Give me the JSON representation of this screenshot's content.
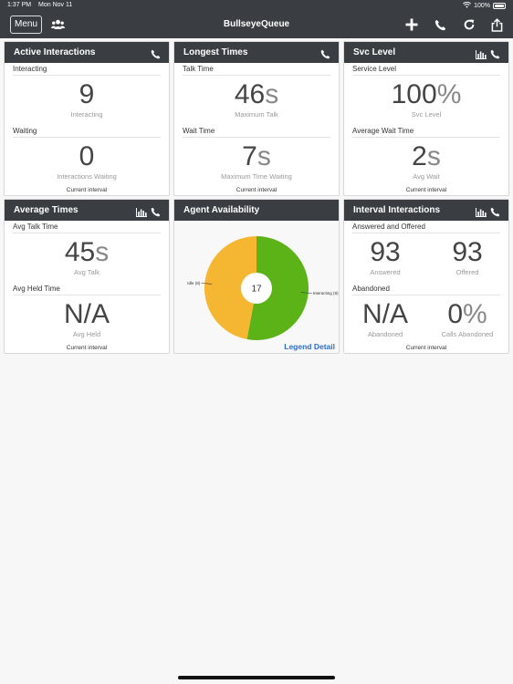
{
  "status_bar": {
    "time": "1:37 PM",
    "date": "Mon Nov 11",
    "battery": "100%"
  },
  "nav": {
    "menu_label": "Menu",
    "title": "BullseyeQueue"
  },
  "panels": {
    "active": {
      "title": "Active Interactions",
      "s1_label": "Interacting",
      "s1_value": "9",
      "s1_sub": "Interacting",
      "s2_label": "Waiting",
      "s2_value": "0",
      "s2_sub": "Interactions Waiting",
      "footer": "Current interval"
    },
    "longest": {
      "title": "Longest Times",
      "s1_label": "Talk Time",
      "s1_value": "46",
      "s1_unit": "s",
      "s1_sub": "Maximum Talk",
      "s2_label": "Wait Time",
      "s2_value": "7",
      "s2_unit": "s",
      "s2_sub": "Maximum Time Waiting",
      "footer": "Current interval"
    },
    "svc": {
      "title": "Svc Level",
      "s1_label": "Service Level",
      "s1_value": "100",
      "s1_unit": "%",
      "s1_sub": "Svc Level",
      "s2_label": "Average Wait Time",
      "s2_value": "2",
      "s2_unit": "s",
      "s2_sub": "Avg Wait",
      "footer": "Current interval"
    },
    "avg": {
      "title": "Average Times",
      "s1_label": "Avg Talk Time",
      "s1_value": "45",
      "s1_unit": "s",
      "s1_sub": "Avg Talk",
      "s2_label": "Avg Held Time",
      "s2_value": "N/A",
      "s2_sub": "Avg Held",
      "footer": "Current interval"
    },
    "agent": {
      "title": "Agent Availability",
      "center_value": "17",
      "legend_link": "Legend Detail"
    },
    "interval": {
      "title": "Interval Interactions",
      "s1_label": "Answered and Offered",
      "answered_value": "93",
      "answered_sub": "Answered",
      "offered_value": "93",
      "offered_sub": "Offered",
      "s2_label": "Abandoned",
      "abandoned_value": "N/A",
      "abandoned_sub": "Abandoned",
      "calls_abandoned_value": "0",
      "calls_abandoned_unit": "%",
      "calls_abandoned_sub": "Calls Abandoned",
      "footer": "Current interval"
    }
  },
  "chart_data": {
    "type": "pie",
    "categories": [
      "Idle (8)",
      "Interacting (9)"
    ],
    "values": [
      8,
      9
    ],
    "colors": [
      "#f5b731",
      "#5cb318"
    ],
    "total": 17
  },
  "colors": {
    "header_bg": "#3a3d42",
    "link": "#2a6fc9"
  }
}
